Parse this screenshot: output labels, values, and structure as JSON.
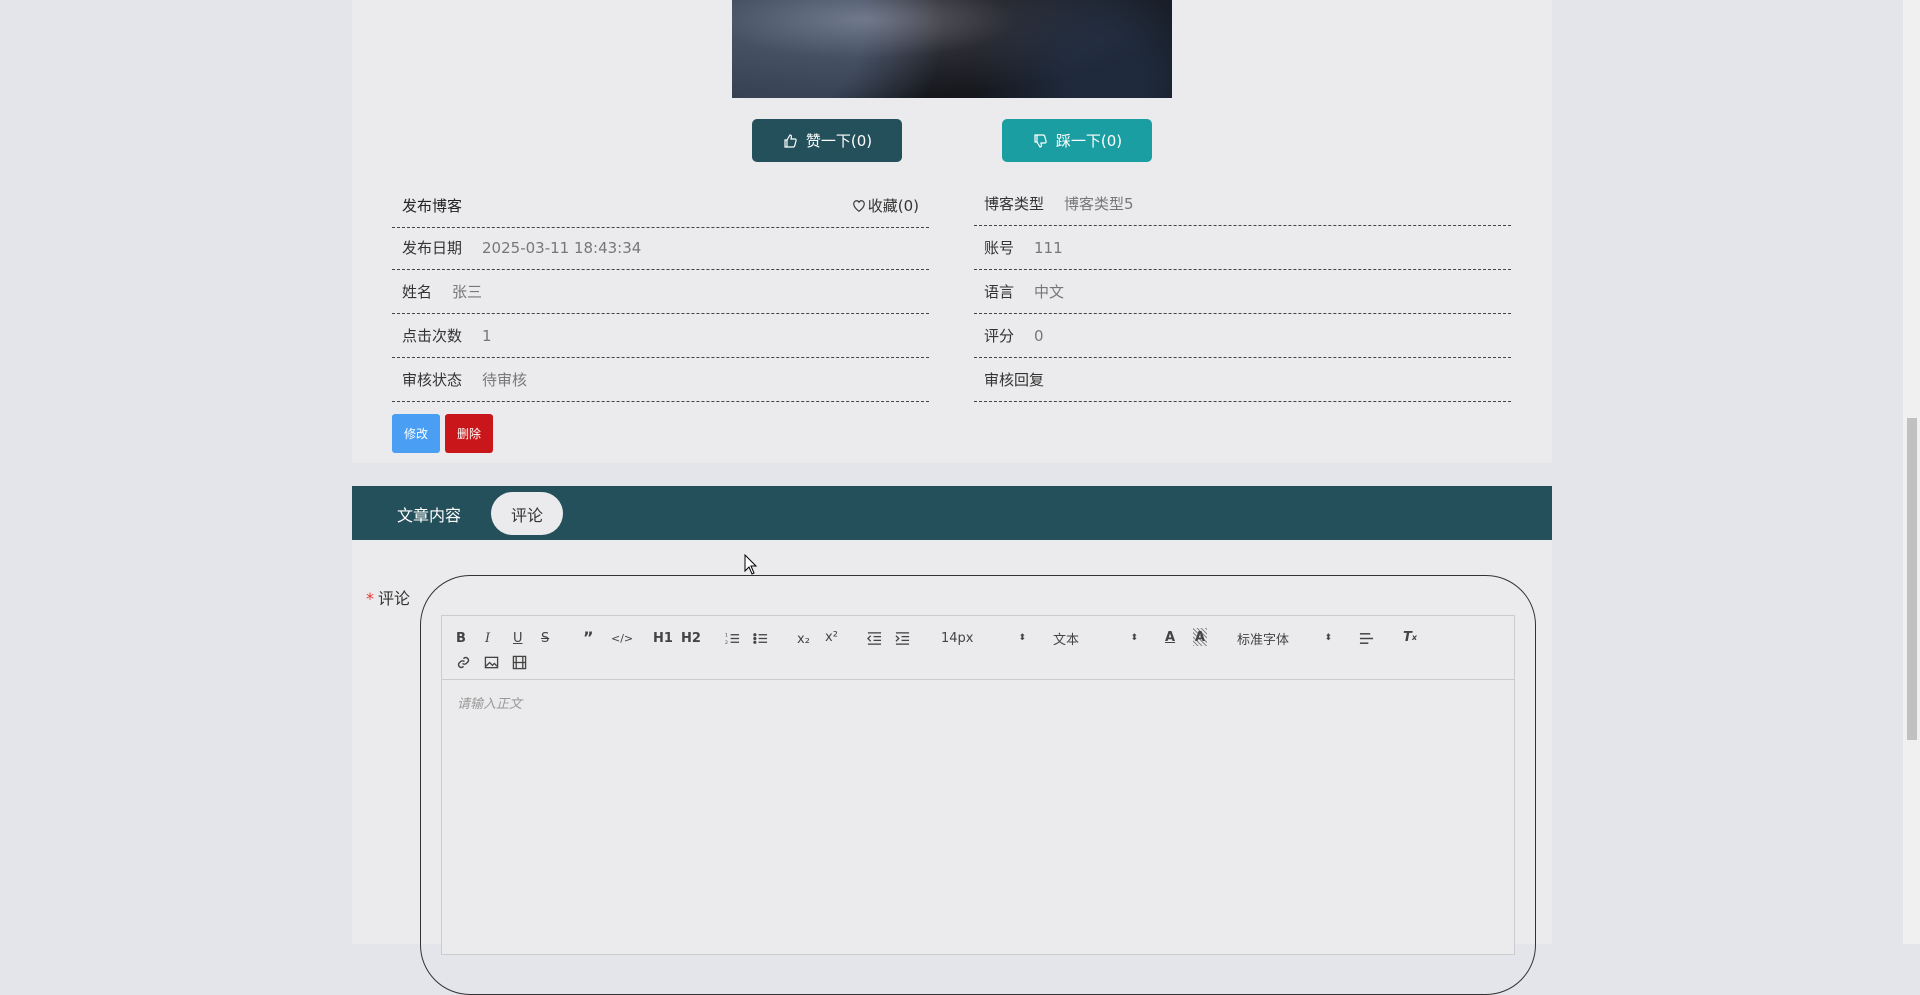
{
  "votes": {
    "up_label": "赞一下(0)",
    "down_label": "踩一下(0)"
  },
  "info": {
    "publish_blog": "发布博客",
    "favorite": "收藏(0)",
    "blog_type_label": "博客类型",
    "blog_type_value": "博客类型5",
    "date_label": "发布日期",
    "date_value": "2025-03-11 18:43:34",
    "account_label": "账号",
    "account_value": "111",
    "name_label": "姓名",
    "name_value": "张三",
    "language_label": "语言",
    "language_value": "中文",
    "clicks_label": "点击次数",
    "clicks_value": "1",
    "score_label": "评分",
    "score_value": "0",
    "review_status_label": "审核状态",
    "review_status_value": "待审核",
    "review_reply_label": "审核回复"
  },
  "actions": {
    "edit": "修改",
    "delete": "删除"
  },
  "tabs": {
    "content": "文章内容",
    "comment": "评论"
  },
  "comment": {
    "label": "评论",
    "required_mark": "*",
    "placeholder": "请输入正文"
  },
  "toolbar": {
    "font_size": "14px",
    "header": "文本",
    "font_family": "标准字体",
    "h1": "H1",
    "h2": "H2",
    "sub": "x₂",
    "sup": "x²"
  },
  "colors": {
    "primary": "#24505b",
    "teal": "#1a9ea2",
    "edit_blue": "#4a9ff5",
    "delete_red": "#c8161a"
  }
}
